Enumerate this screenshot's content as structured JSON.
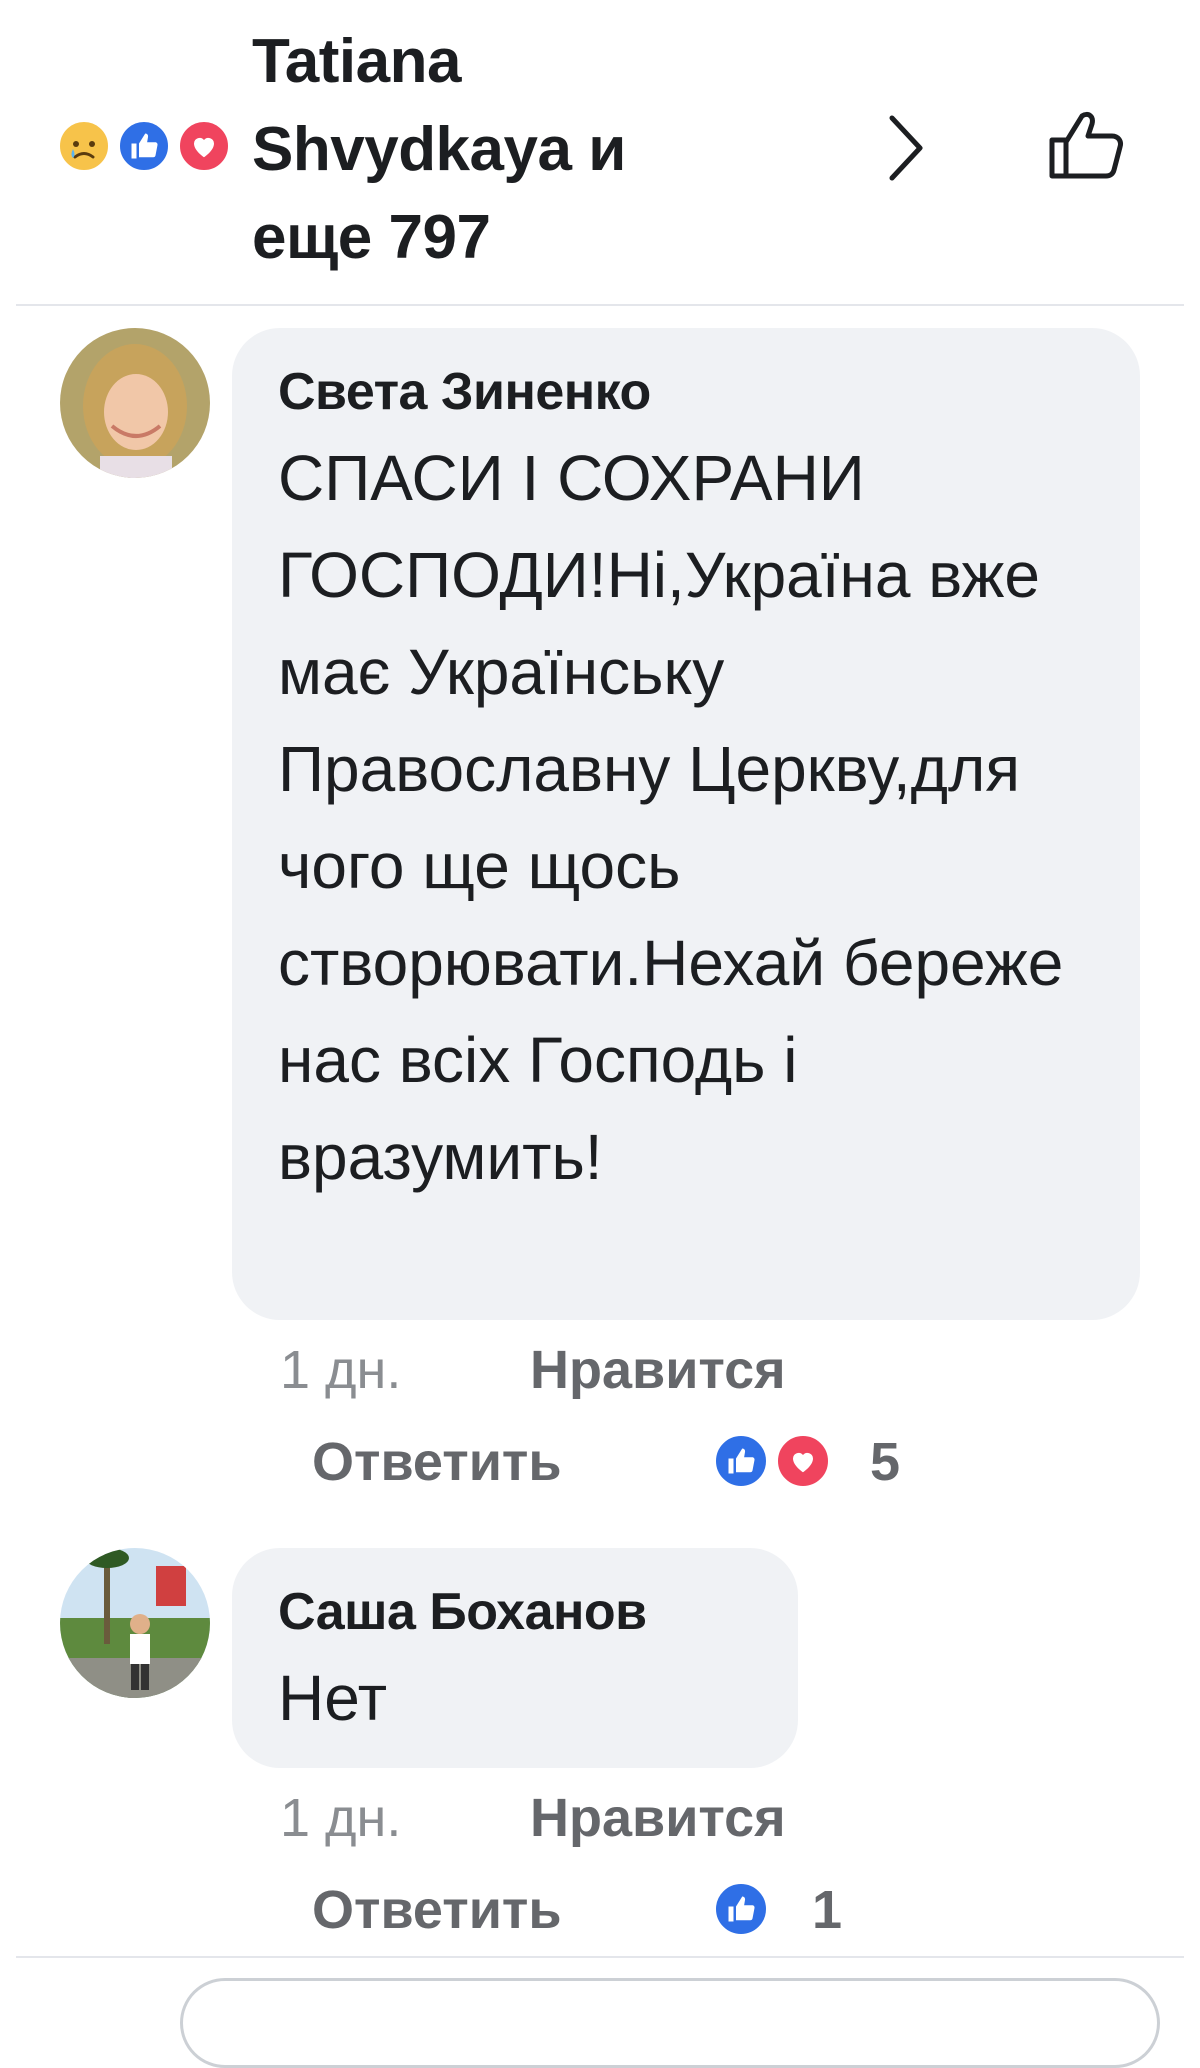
{
  "header": {
    "reactions": [
      "sad-icon",
      "like-icon",
      "love-icon"
    ],
    "title": "Tatiana Shvydkaya и еще 797"
  },
  "comments": [
    {
      "author": "Света Зиненко",
      "text": "СПАСИ І СОХРАНИ ГОСПОДИ!Ні,Україна вже має Українську Православну Церкву,для чого ще щось створювати.Нехай береже нас всіх Господь і вразумить!",
      "time": "1 дн.",
      "like_label": "Нравится",
      "reply_label": "Ответить",
      "reactions": [
        "like-icon",
        "love-icon"
      ],
      "reaction_count": "5"
    },
    {
      "author": "Саша Боханов",
      "text": "Нет",
      "time": "1 дн.",
      "like_label": "Нравится",
      "reply_label": "Ответить",
      "reactions": [
        "like-icon"
      ],
      "reaction_count": "1"
    }
  ],
  "colors": {
    "like_blue": "#2f6fe6",
    "love_red": "#f0445e",
    "sad_yellow": "#f7c34a",
    "bubble_bg": "#f0f2f5",
    "meta_gray": "#65676b"
  }
}
